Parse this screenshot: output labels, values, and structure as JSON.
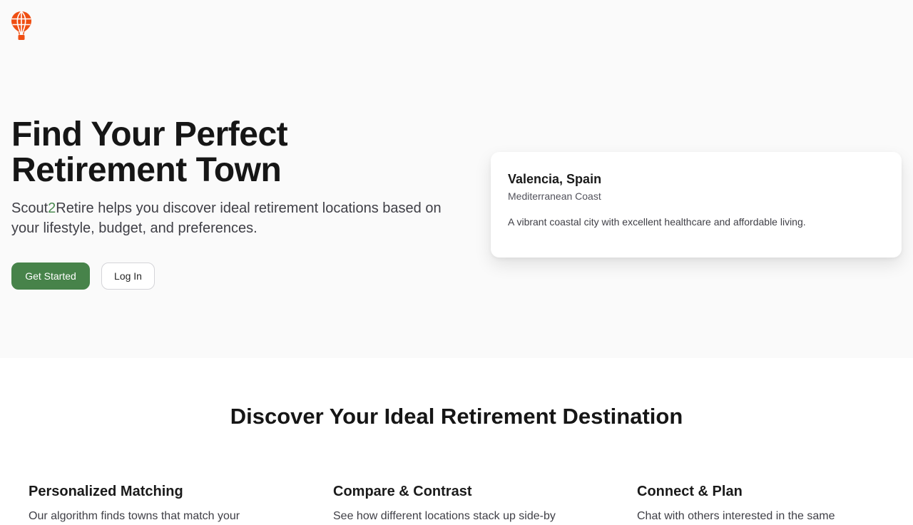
{
  "brand": {
    "logo_icon": "hot-air-balloon-icon",
    "logo_color": "#ef4e12",
    "name_prefix": "Scout",
    "name_number": "2",
    "name_suffix": "Retire",
    "accent": "#47834a"
  },
  "hero": {
    "title_line1": "Find Your Perfect",
    "title_line2": "Retirement Town",
    "subtitle_rest": " helps you discover ideal retirement locations based on your lifestyle, budget, and preferences.",
    "get_started_label": "Get Started",
    "login_label": "Log In"
  },
  "featured_town": {
    "name": "Valencia, Spain",
    "region": "Mediterranean Coast",
    "description": "A vibrant coastal city with excellent healthcare and affordable living."
  },
  "features_section": {
    "title": "Discover Your Ideal Retirement Destination",
    "items": [
      {
        "title": "Personalized Matching",
        "description": "Our algorithm finds towns that match your"
      },
      {
        "title": "Compare & Contrast",
        "description": "See how different locations stack up side-by"
      },
      {
        "title": "Connect & Plan",
        "description": "Chat with others interested in the same"
      }
    ]
  }
}
